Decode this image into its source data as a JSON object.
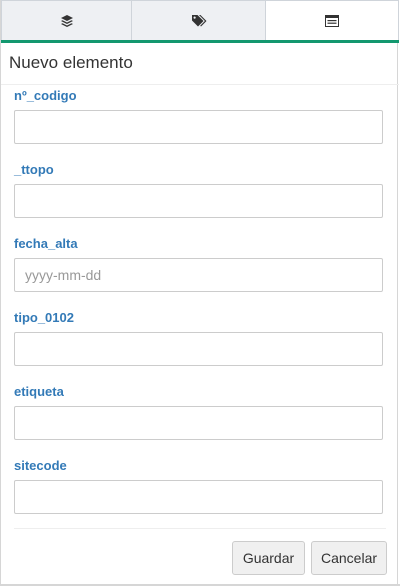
{
  "tabs": [
    {
      "icon": "layers-icon"
    },
    {
      "icon": "tags-icon"
    },
    {
      "icon": "list-icon"
    }
  ],
  "colors": {
    "accent": "#13986f",
    "label": "#337ab7"
  },
  "header": {
    "title": "Nuevo elemento"
  },
  "fields": [
    {
      "label": "nº_codigo",
      "value": "",
      "placeholder": ""
    },
    {
      "label": "_ttopo",
      "value": "",
      "placeholder": ""
    },
    {
      "label": "fecha_alta",
      "value": "",
      "placeholder": "yyyy-mm-dd"
    },
    {
      "label": "tipo_0102",
      "value": "",
      "placeholder": ""
    },
    {
      "label": "etiqueta",
      "value": "",
      "placeholder": ""
    },
    {
      "label": "sitecode",
      "value": "",
      "placeholder": ""
    }
  ],
  "buttons": {
    "save": "Guardar",
    "cancel": "Cancelar"
  }
}
